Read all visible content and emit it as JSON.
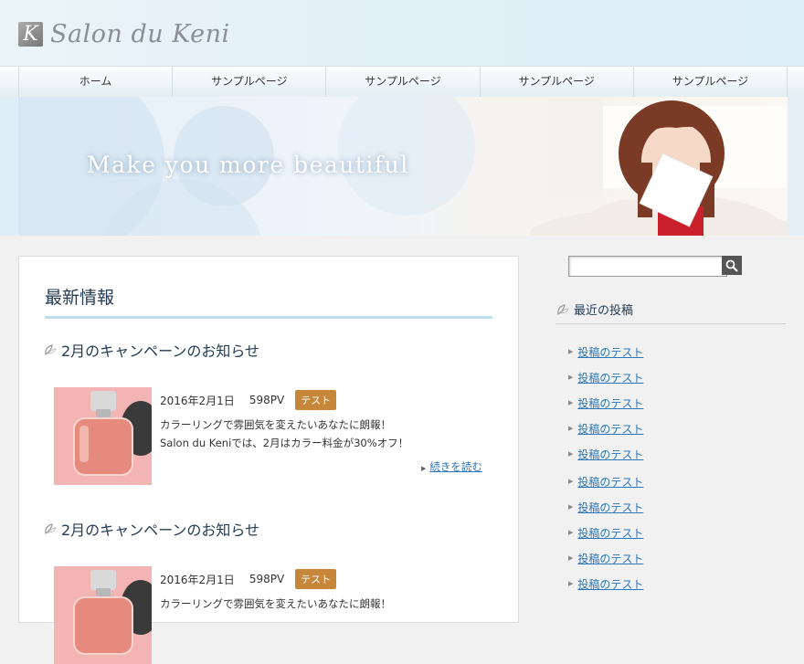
{
  "site": {
    "logo_letter": "K",
    "title": "Salon du Keni"
  },
  "nav": {
    "items": [
      {
        "label": "ホーム"
      },
      {
        "label": "サンプルページ"
      },
      {
        "label": "サンプルページ"
      },
      {
        "label": "サンプルページ"
      },
      {
        "label": "サンプルページ"
      }
    ]
  },
  "hero": {
    "tagline": "Make you more beautiful"
  },
  "main": {
    "heading": "最新情報",
    "posts": [
      {
        "title": "2月のキャンペーンのお知らせ",
        "date": "2016年2月1日",
        "pv": "598PV",
        "category": "テスト",
        "excerpt_line1": "カラーリングで雰囲気を変えたいあなたに朗報！",
        "excerpt_line2": "Salon du Keniでは、2月はカラー料金が30%オフ！",
        "read_more": "続きを読む"
      },
      {
        "title": "2月のキャンペーンのお知らせ",
        "date": "2016年2月1日",
        "pv": "598PV",
        "category": "テスト",
        "excerpt_line1": "カラーリングで雰囲気を変えたいあなたに朗報！"
      }
    ]
  },
  "sidebar": {
    "search_value": "",
    "search_icon": "search-icon",
    "recent_heading": "最近の投稿",
    "recent_items": [
      "投稿のテスト",
      "投稿のテスト",
      "投稿のテスト",
      "投稿のテスト",
      "投稿のテスト",
      "投稿のテスト",
      "投稿のテスト",
      "投稿のテスト",
      "投稿のテスト",
      "投稿のテスト"
    ]
  },
  "colors": {
    "accent_badge": "#c7873b",
    "link": "#2b76b9",
    "heading": "#243b55",
    "title_rule": "#bcdfee"
  }
}
